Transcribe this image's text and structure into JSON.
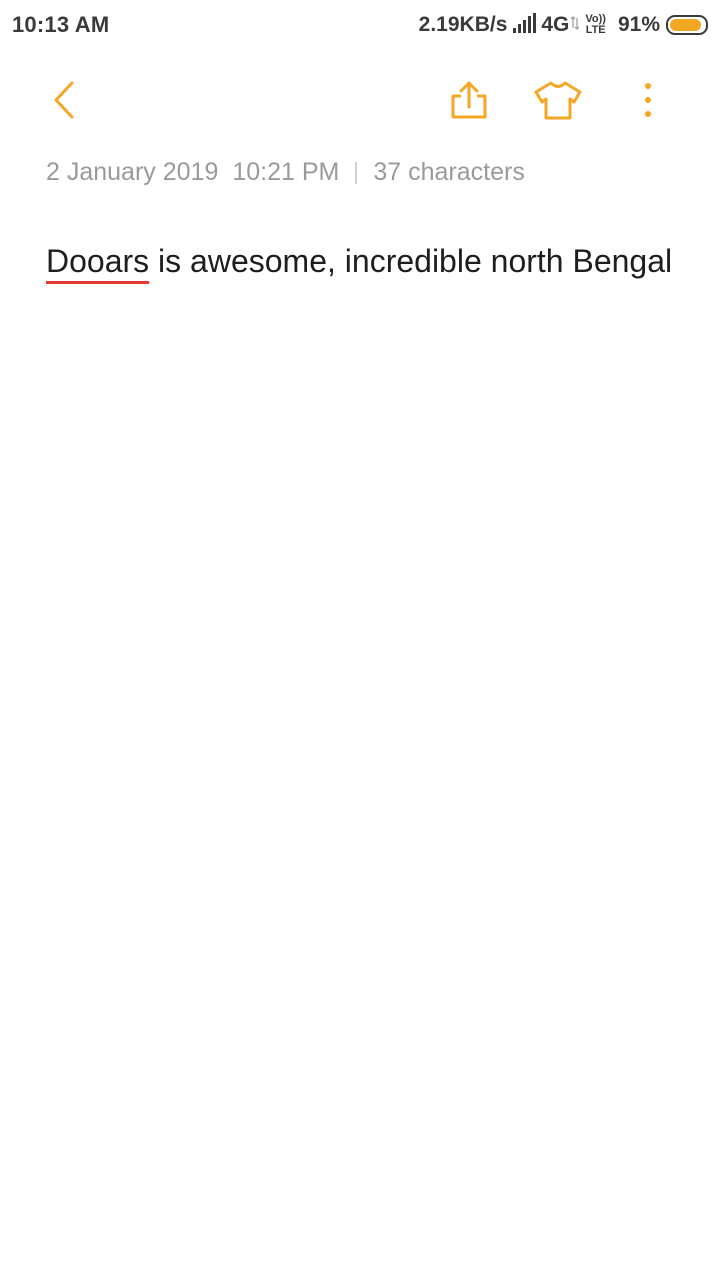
{
  "status_bar": {
    "time": "10:13 AM",
    "net_speed": "2.19KB/s",
    "network_type": "4G",
    "volte_top": "Vo))",
    "volte_bottom": "LTE",
    "battery_percent": "91%",
    "battery_level": 0.91,
    "battery_color": "#f5a623"
  },
  "toolbar": {
    "accent_color": "#f5a623",
    "back_icon": "chevron-left-icon",
    "share_icon": "share-icon",
    "theme_icon": "tshirt-icon",
    "more_icon": "more-vertical-icon"
  },
  "meta": {
    "date": "2 January 2019",
    "time": "10:21 PM",
    "char_count": "37 characters"
  },
  "note": {
    "misspelled_word": "Dooars",
    "rest_text": " is awesome, incredible north Bengal"
  }
}
